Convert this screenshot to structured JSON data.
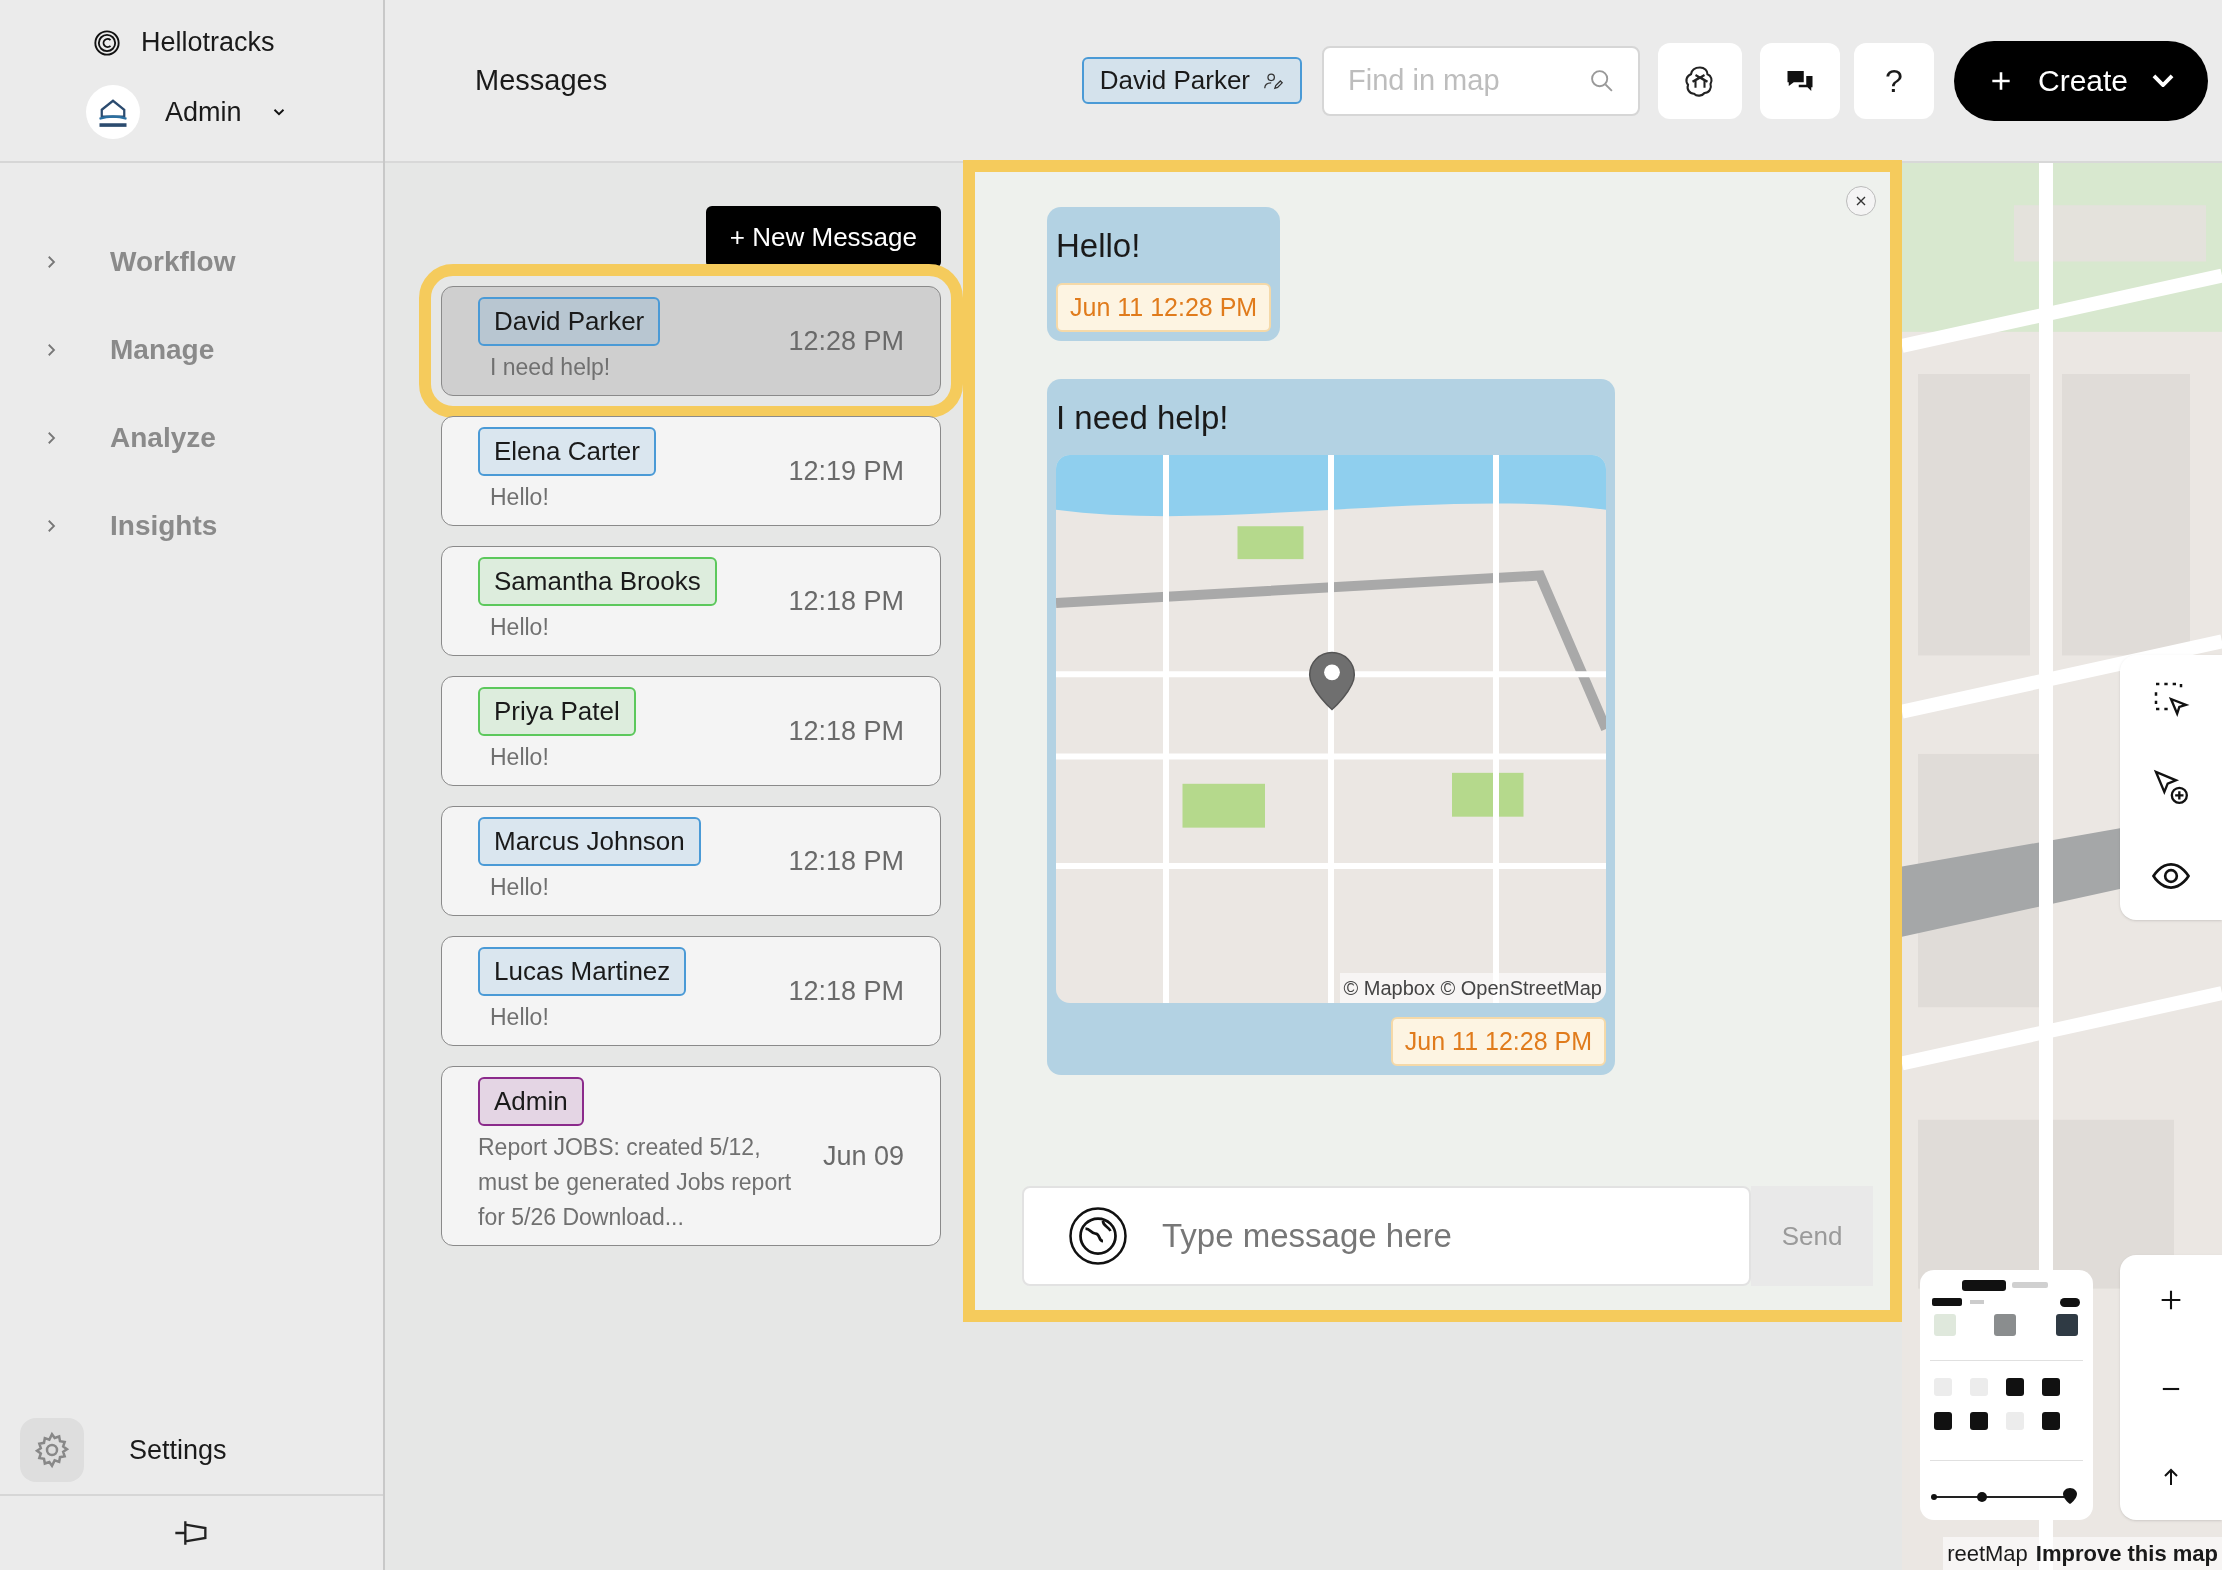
{
  "sidebar": {
    "brand": "Hellotracks",
    "account": {
      "name": "Admin"
    },
    "nav_items": [
      {
        "label": "Workflow"
      },
      {
        "label": "Manage"
      },
      {
        "label": "Analyze"
      },
      {
        "label": "Insights"
      }
    ],
    "settings_label": "Settings"
  },
  "header": {
    "title": "Messages",
    "user_chip": "David Parker",
    "search": {
      "placeholder": "Find in map"
    },
    "help_label": "?",
    "create_label": "Create"
  },
  "conversations": {
    "new_message_label": "+ New Message",
    "items": [
      {
        "name": "David Parker",
        "color": "#4a9ad6",
        "preview": "I need help!",
        "time": "12:28 PM",
        "selected": true
      },
      {
        "name": "Elena Carter",
        "color": "#4a9ad6",
        "preview": "Hello!",
        "time": "12:19 PM",
        "selected": false
      },
      {
        "name": "Samantha Brooks",
        "color": "#5cc85c",
        "preview": "Hello!",
        "time": "12:18 PM",
        "selected": false
      },
      {
        "name": "Priya Patel",
        "color": "#5cc85c",
        "preview": "Hello!",
        "time": "12:18 PM",
        "selected": false
      },
      {
        "name": "Marcus Johnson",
        "color": "#4a9ad6",
        "preview": "Hello!",
        "time": "12:18 PM",
        "selected": false
      },
      {
        "name": "Lucas Martinez",
        "color": "#4a9ad6",
        "preview": "Hello!",
        "time": "12:18 PM",
        "selected": false
      },
      {
        "name": "Admin",
        "color": "#8b2a8b",
        "preview": "Report JOBS: created 5/12, must be generated Jobs report for 5/26 Download...",
        "time": "Jun 09",
        "selected": false
      }
    ]
  },
  "chat": {
    "messages": [
      {
        "kind": "text",
        "text": "Hello!",
        "time": "Jun 11 12:28 PM"
      },
      {
        "kind": "location",
        "text": "I need help!",
        "map_attribution": "© Mapbox © OpenStreetMap",
        "time": "Jun 11 12:28 PM"
      }
    ],
    "input": {
      "placeholder": "Type message here"
    },
    "send_label": "Send",
    "send_disabled": true
  },
  "map": {
    "attribution": [
      "reetMap",
      "Improve this map"
    ]
  }
}
